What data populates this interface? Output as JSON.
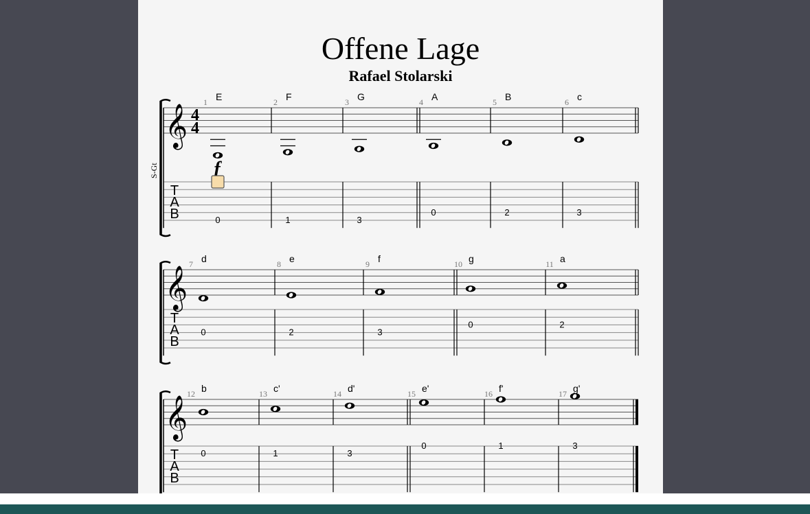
{
  "score": {
    "title": "Offene Lage",
    "composer": "Rafael Stolarski",
    "instrument": "S-Gt",
    "time_signature": {
      "num": "4",
      "den": "4"
    },
    "dynamic": "f",
    "tab_clef": [
      "T",
      "A",
      "B"
    ],
    "systems": [
      {
        "measures": [
          {
            "number": "1",
            "chord": "E",
            "note_step": -5,
            "ledger": 2,
            "fret": "0",
            "string": 6
          },
          {
            "number": "2",
            "chord": "F",
            "note_step": -4,
            "ledger": 2,
            "fret": "1",
            "string": 6
          },
          {
            "number": "3",
            "chord": "G",
            "note_step": -3,
            "ledger": 1,
            "fret": "3",
            "string": 6
          },
          {
            "number": "4",
            "chord": "A",
            "note_step": -2,
            "ledger": 1,
            "fret": "0",
            "string": 5,
            "double_bar_before": true
          },
          {
            "number": "5",
            "chord": "B",
            "note_step": -1,
            "ledger": 0,
            "fret": "2",
            "string": 5
          },
          {
            "number": "6",
            "chord": "c",
            "note_step": 0,
            "ledger": 0,
            "fret": "3",
            "string": 5
          }
        ],
        "end": "double"
      },
      {
        "measures": [
          {
            "number": "7",
            "chord": "d",
            "note_step": 1,
            "ledger": 0,
            "fret": "0",
            "string": 4
          },
          {
            "number": "8",
            "chord": "e",
            "note_step": 2,
            "ledger": 0,
            "fret": "2",
            "string": 4
          },
          {
            "number": "9",
            "chord": "f",
            "note_step": 3,
            "ledger": 0,
            "fret": "3",
            "string": 4
          },
          {
            "number": "10",
            "chord": "g",
            "note_step": 4,
            "ledger": 0,
            "fret": "0",
            "string": 3,
            "double_bar_before": true
          },
          {
            "number": "11",
            "chord": "a",
            "note_step": 5,
            "ledger": 0,
            "fret": "2",
            "string": 3
          }
        ],
        "end": "double"
      },
      {
        "measures": [
          {
            "number": "12",
            "chord": "b",
            "note_step": 6,
            "ledger": 0,
            "fret": "0",
            "string": 2
          },
          {
            "number": "13",
            "chord": "c'",
            "note_step": 7,
            "ledger": 0,
            "fret": "1",
            "string": 2
          },
          {
            "number": "14",
            "chord": "d'",
            "note_step": 8,
            "ledger": 0,
            "fret": "3",
            "string": 2
          },
          {
            "number": "15",
            "chord": "e'",
            "note_step": 9,
            "ledger": 0,
            "fret": "0",
            "string": 1,
            "double_bar_before": true
          },
          {
            "number": "16",
            "chord": "f'",
            "note_step": 10,
            "ledger": 0,
            "fret": "1",
            "string": 1
          },
          {
            "number": "17",
            "chord": "g'",
            "note_step": 11,
            "ledger": 0,
            "fret": "3",
            "string": 1
          }
        ],
        "end": "final"
      }
    ]
  }
}
